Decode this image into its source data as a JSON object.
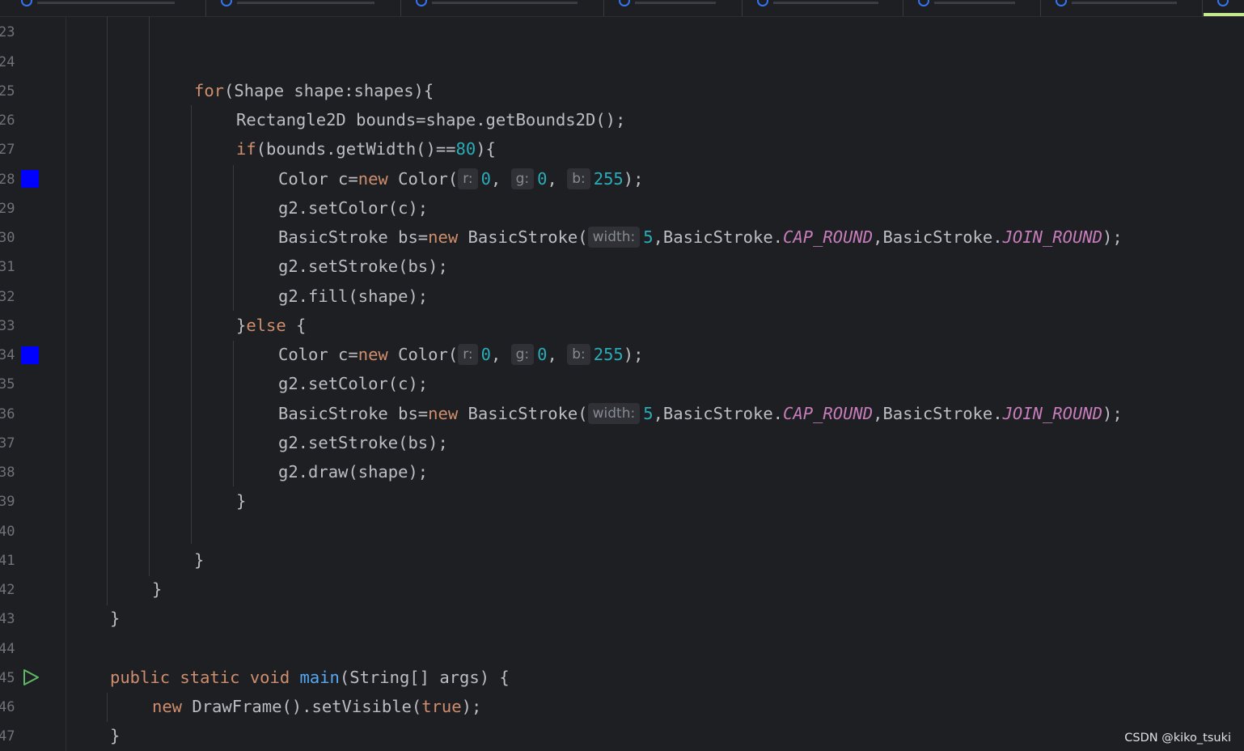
{
  "editor": {
    "line_numbers": [
      "23",
      "24",
      "25",
      "26",
      "27",
      "28",
      "29",
      "30",
      "31",
      "32",
      "33",
      "34",
      "35",
      "36",
      "37",
      "38",
      "39",
      "40",
      "41",
      "42",
      "43",
      "44",
      "45",
      "46",
      "47"
    ],
    "swatch_color": "#0000ff",
    "accent_underline": "#c3e88d",
    "code": {
      "l25": {
        "kw_for": "for",
        "rest": "(Shape shape:shapes){"
      },
      "l26": {
        "text": "Rectangle2D bounds=shape.getBounds2D();"
      },
      "l27": {
        "kw_if": "if",
        "mid": "(bounds.getWidth()==",
        "num": "80",
        "end": "){"
      },
      "l28": {
        "pre": "Color c=",
        "kw_new": "new",
        "mid": " Color(",
        "hint_r": "r:",
        "r": "0",
        "sep1": ",",
        "hint_g": "g:",
        "g": "0",
        "sep2": ",",
        "hint_b": "b:",
        "b": "255",
        "end": ");"
      },
      "l29": {
        "text": "g2.setColor(c);"
      },
      "l30": {
        "pre": "BasicStroke bs=",
        "kw_new": "new",
        "mid": " BasicStroke(",
        "hint_width": "width:",
        "width": "5",
        "c1": ",BasicStroke.",
        "cap": "CAP_ROUND",
        "c2": ",BasicStroke.",
        "join": "JOIN_ROUND",
        "end": ");"
      },
      "l31": {
        "text": "g2.setStroke(bs);"
      },
      "l32": {
        "text": "g2.fill(shape);"
      },
      "l33": {
        "pre": "}",
        "kw_else": "else",
        "end": " {"
      },
      "l34": {
        "pre": "Color c=",
        "kw_new": "new",
        "mid": " Color(",
        "hint_r": "r:",
        "r": "0",
        "sep1": ",",
        "hint_g": "g:",
        "g": "0",
        "sep2": ",",
        "hint_b": "b:",
        "b": "255",
        "end": ");"
      },
      "l35": {
        "text": "g2.setColor(c);"
      },
      "l36": {
        "pre": "BasicStroke bs=",
        "kw_new": "new",
        "mid": " BasicStroke(",
        "hint_width": "width:",
        "width": "5",
        "c1": ",BasicStroke.",
        "cap": "CAP_ROUND",
        "c2": ",BasicStroke.",
        "join": "JOIN_ROUND",
        "end": ");"
      },
      "l37": {
        "text": "g2.setStroke(bs);"
      },
      "l38": {
        "text": "g2.draw(shape);"
      },
      "l39": {
        "text": "}"
      },
      "l41": {
        "text": "}"
      },
      "l42": {
        "text": "}"
      },
      "l43": {
        "text": "}"
      },
      "l45": {
        "kw1": "public",
        "kw2": "static",
        "kw3": "void",
        "fn": "main",
        "rest": "(String[] args) {"
      },
      "l46": {
        "kw_new": "new",
        "mid": " DrawFrame().setVisible(",
        "kw_true": "true",
        "end": ");"
      },
      "l47": {
        "text": "}"
      }
    }
  },
  "watermark": "CSDN @kiko_tsuki"
}
